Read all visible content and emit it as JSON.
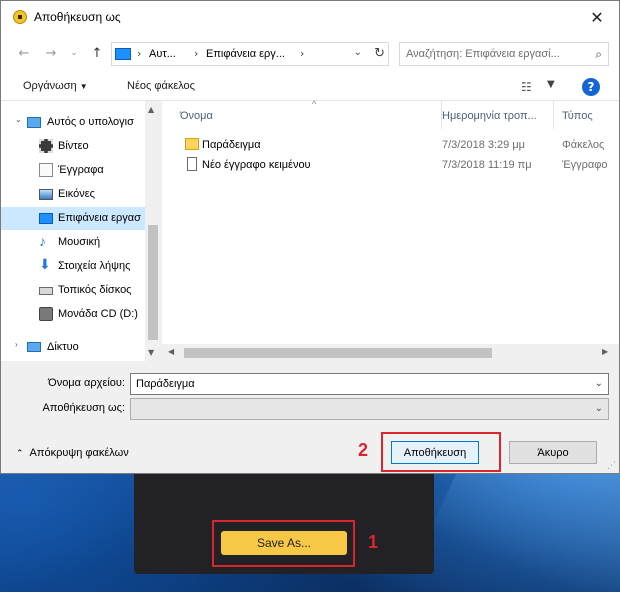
{
  "dialog": {
    "title": "Αποθήκευση ως",
    "close_glyph": "✕"
  },
  "address": {
    "crumbs": [
      "Αυτ...",
      "Επιφάνεια εργ..."
    ],
    "separator": "›",
    "dropdown": "⌄",
    "refresh": "↻"
  },
  "search": {
    "placeholder": "Αναζήτηση: Επιφάνεια εργασί...",
    "icon": "search-icon"
  },
  "toolbar": {
    "organize_label": "Οργάνωση",
    "new_folder_label": "Νέος φάκελος",
    "help_label": "?"
  },
  "navpane": {
    "items": [
      {
        "label": "Αυτός ο υπολογισ",
        "icon": "computer-icon"
      },
      {
        "label": "Βίντεο",
        "icon": "video-icon"
      },
      {
        "label": "Έγγραφα",
        "icon": "documents-icon"
      },
      {
        "label": "Εικόνες",
        "icon": "pictures-icon"
      },
      {
        "label": "Επιφάνεια εργασ",
        "icon": "desktop-icon",
        "selected": true
      },
      {
        "label": "Μουσική",
        "icon": "music-icon"
      },
      {
        "label": "Στοιχεία λήψης",
        "icon": "downloads-icon"
      },
      {
        "label": "Τοπικός δίσκος",
        "icon": "drive-icon"
      },
      {
        "label": "Μονάδα CD (D:)",
        "icon": "cd-drive-icon"
      },
      {
        "label": "Δίκτυο",
        "icon": "network-icon"
      }
    ]
  },
  "filelist": {
    "columns": [
      "Όνομα",
      "Ημερομηνία τροπ...",
      "Τύπος"
    ],
    "rows": [
      {
        "name": "Παράδειγμα",
        "date": "7/3/2018 3:29 μμ",
        "type": "Φάκελος",
        "icon": "folder-icon"
      },
      {
        "name": "Νέο έγγραφο κειμένου",
        "date": "7/3/2018 11:19 πμ",
        "type": "Έγγραφο",
        "icon": "text-file-icon"
      }
    ]
  },
  "form": {
    "filename_label": "Όνομα αρχείου:",
    "filename_value": "Παράδειγμα",
    "savetype_label": "Αποθήκευση ως:",
    "savetype_value": ""
  },
  "footer": {
    "hide_folders_label": "Απόκρυψη φακέλων",
    "save_label": "Αποθήκευση",
    "cancel_label": "Άκυρο"
  },
  "app": {
    "save_as_label": "Save As..."
  },
  "annotations": {
    "step1": "1",
    "step2": "2",
    "color": "#d8262c"
  }
}
